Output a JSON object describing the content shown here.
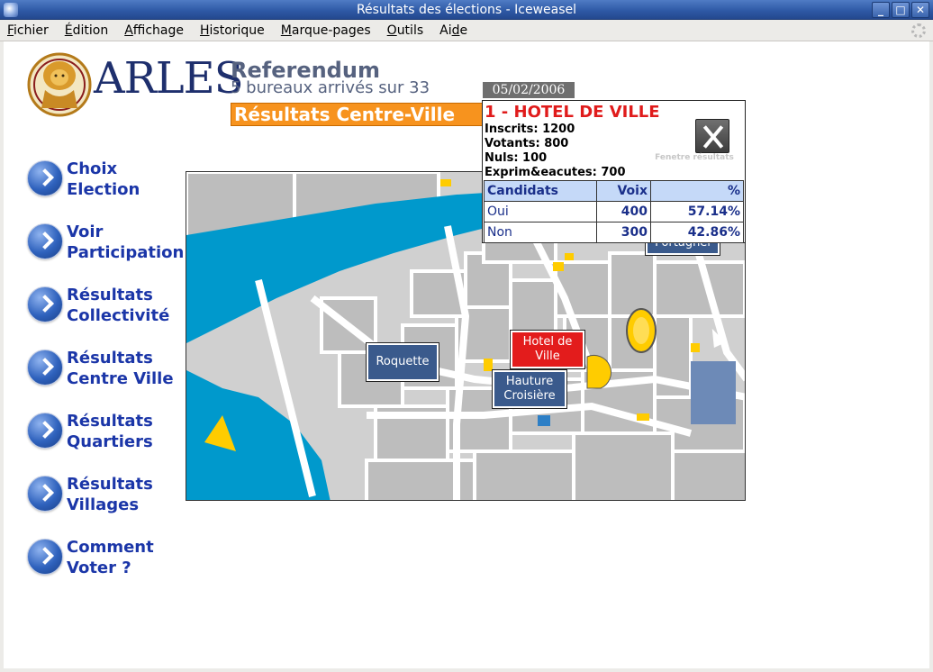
{
  "window": {
    "title": "Résultats des élections - Iceweasel",
    "minimize": "_",
    "maximize": "□",
    "close": "✕"
  },
  "menubar": {
    "items": [
      {
        "pre": "",
        "acc": "F",
        "post": "ichier"
      },
      {
        "pre": "",
        "acc": "É",
        "post": "dition"
      },
      {
        "pre": "",
        "acc": "A",
        "post": "ffichage"
      },
      {
        "pre": "",
        "acc": "H",
        "post": "istorique"
      },
      {
        "pre": "",
        "acc": "M",
        "post": "arque-pages"
      },
      {
        "pre": "",
        "acc": "O",
        "post": "utils"
      },
      {
        "pre": "Ai",
        "acc": "d",
        "post": "e"
      }
    ]
  },
  "header": {
    "brand": "ARLES",
    "title": "Referendum",
    "subtitle": "5 bureaux arrivés sur 33",
    "date": "05/02/2006",
    "banner": "Résultats Centre-Ville"
  },
  "nav": {
    "items": [
      {
        "line1": "Choix",
        "line2": "Election"
      },
      {
        "line1": "Voir",
        "line2": "Participation"
      },
      {
        "line1": "Résultats",
        "line2": "Collectivité"
      },
      {
        "line1": "Résultats",
        "line2": "Centre Ville"
      },
      {
        "line1": "Résultats",
        "line2": "Quartiers"
      },
      {
        "line1": "Résultats",
        "line2": "Villages"
      },
      {
        "line1": "Comment",
        "line2": "Voter ?"
      }
    ]
  },
  "map": {
    "labels": {
      "roquette": "Roquette",
      "hotel_line1": "Hotel de",
      "hotel_line2": "Ville",
      "hauture_line1": "Hauture",
      "hauture_line2": "Croisière",
      "portagnel": "Portagnel"
    },
    "colors": {
      "river": "#0099cc",
      "street": "#ffffff",
      "block": "#c8c8c8",
      "monument": "#ffcc00"
    }
  },
  "popup": {
    "title": "1 - HOTEL DE VILLE",
    "inscrits": "Inscrits: 1200",
    "votants": "Votants: 800",
    "nuls": "Nuls: 100",
    "exprimes": "Exprim&eacutes: 700",
    "close_caption": "Fenetre résultats",
    "table": {
      "headers": [
        "Candidats",
        "Voix",
        "%"
      ],
      "rows": [
        {
          "name": "Oui",
          "votes": "400",
          "pct": "57.14%"
        },
        {
          "name": "Non",
          "votes": "300",
          "pct": "42.86%"
        }
      ]
    }
  }
}
